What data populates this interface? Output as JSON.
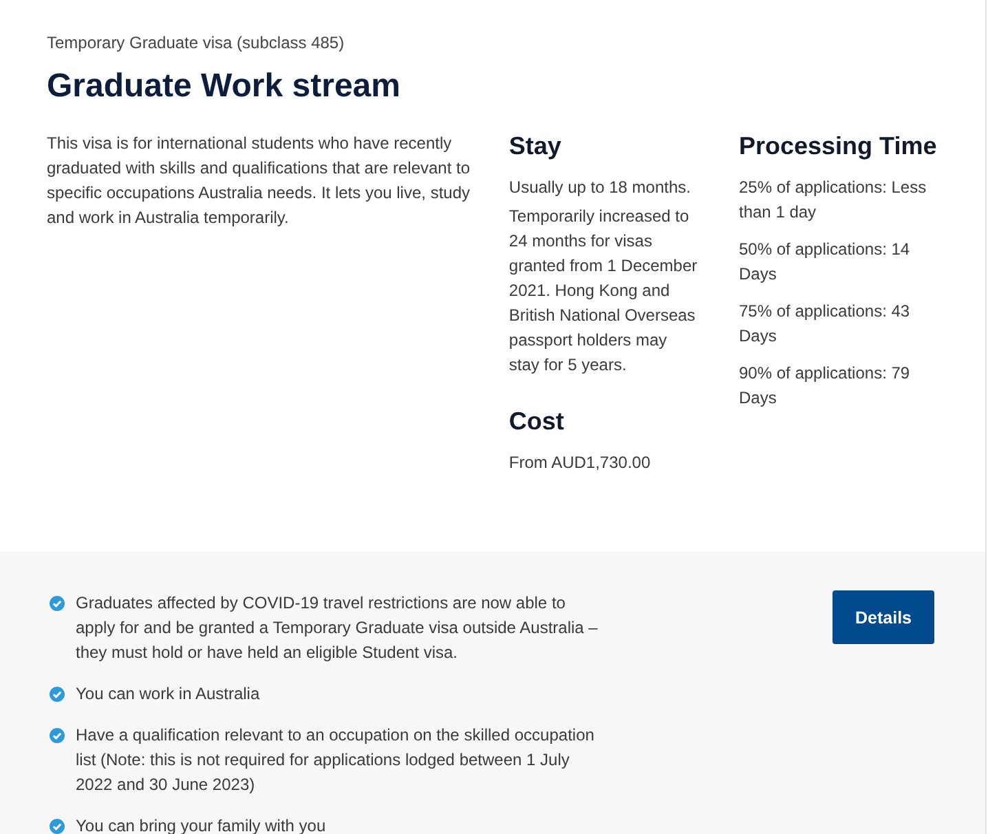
{
  "subtitle": "Temporary Graduate visa (subclass 485)",
  "title": "Graduate Work stream",
  "description": "This visa is for international students who have recently graduated with skills and qualifications that are relevant to specific occupations Australia needs. It lets you live, study and work in Australia temporarily.",
  "stay": {
    "heading": "Stay",
    "paragraphs": [
      "Usually up to 18 months.",
      "Temporarily increased to 24 months for visas granted from 1 December 2021. Hong Kong and British National Overseas passport holders may stay for 5 years."
    ]
  },
  "cost": {
    "heading": "Cost",
    "paragraphs": [
      "From AUD1,730.00"
    ]
  },
  "processing_time": {
    "heading": "Processing Time",
    "paragraphs": [
      "25% of applications: Less than 1 day",
      "50% of applications: 14 Days",
      "75% of applications: 43 Days",
      "90% of applications: 79 Days"
    ]
  },
  "highlights": [
    {
      "text": "Graduates affected by COVID-19 travel restrictions are now able to apply for and be granted a Temporary Graduate visa outside Australia – they must hold or have held an eligible Student visa."
    },
    {
      "text": "You can work in Australia"
    },
    {
      "text": "Have a qualification relevant to an occupation on the skilled occupation list (Note: this is not required for applications lodged between 1 July 2022 and 30 June 2023)"
    },
    {
      "text": "You can bring your family with you"
    }
  ],
  "button": "Details"
}
